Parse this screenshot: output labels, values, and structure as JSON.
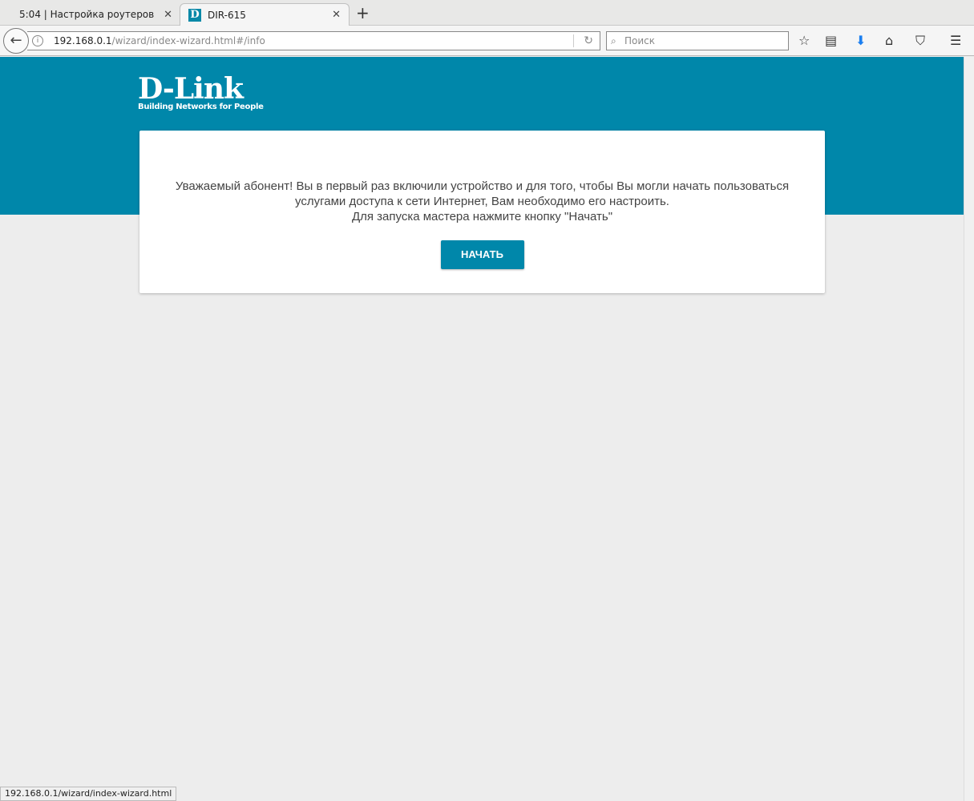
{
  "browser": {
    "tabs": [
      {
        "label": "5:04 | Настройка роутеров"
      },
      {
        "label": "DIR-615",
        "favicon": "D"
      }
    ],
    "url_host": "192.168.0.1",
    "url_path": "/wizard/index-wizard.html#/info",
    "search_placeholder": "Поиск",
    "status_url": "192.168.0.1/wizard/index-wizard.html"
  },
  "brand": {
    "logo": "D-Link",
    "tagline": "Building Networks for People",
    "color": "#0087aa"
  },
  "card": {
    "line1": "Уважаемый абонент! Вы в первый раз включили устройство и для того, чтобы Вы могли начать пользоваться",
    "line2": "услугами доступа к сети Интернет, Вам необходимо его настроить.",
    "line3": "Для запуска мастера нажмите кнопку \"Начать\"",
    "button": "НАЧАТЬ"
  }
}
